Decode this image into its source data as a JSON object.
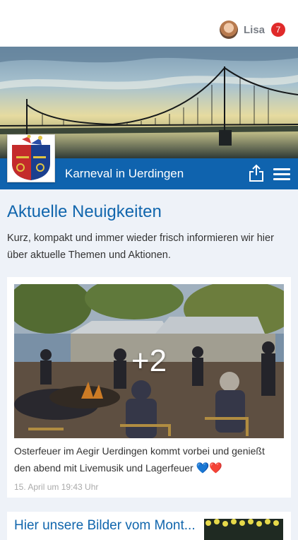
{
  "user": {
    "name": "Lisa",
    "notifications": "7"
  },
  "header": {
    "title": "Karneval in Uerdingen"
  },
  "news": {
    "heading": "Aktuelle Neuigkeiten",
    "intro": "Kurz, kompakt und immer wieder frisch informieren wir hier über aktuelle Themen und Aktionen."
  },
  "post": {
    "more_photos": "+2",
    "caption": "Osterfeuer im Aegir Uerdingen kommt vorbei und genießt den abend mit Livemusik und Lagerfeuer",
    "emoji": "💙❤️",
    "date": "15. April um 19:43 Uhr"
  },
  "post2": {
    "title": "Hier unsere Bilder vom Mont..."
  },
  "icons": {
    "share": "share-icon",
    "menu": "hamburger-menu-icon",
    "logo": "club-crest-logo"
  }
}
